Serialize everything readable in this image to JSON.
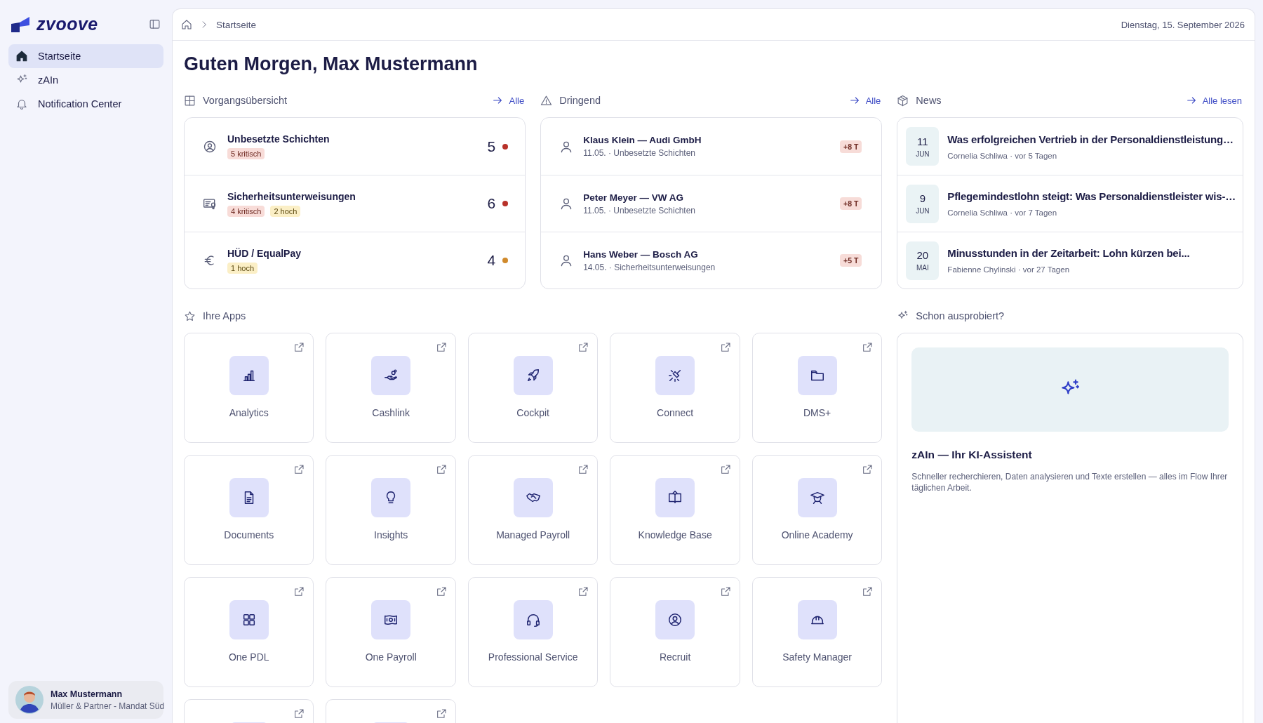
{
  "sidebar": {
    "brand": "zvoove",
    "items": [
      {
        "label": "Startseite",
        "selected": true
      },
      {
        "label": "zAIn",
        "selected": false
      },
      {
        "label": "Notification Center",
        "selected": false
      }
    ],
    "user": {
      "name": "Max Mustermann",
      "org": "Müller & Partner - Mandat Süd"
    }
  },
  "topbar": {
    "breadcrumb": [
      "Startseite"
    ],
    "date": "Dienstag, 15. September 2026"
  },
  "greeting": "Guten Morgen, Max Mustermann",
  "overview": {
    "title": "Vorgangsübersicht",
    "link": "Alle",
    "items": [
      {
        "title": "Unbesetzte Schichten",
        "badges": [
          {
            "text": "5 kritisch",
            "kind": "critical"
          }
        ],
        "count": "5",
        "color": "#b8322a"
      },
      {
        "title": "Sicherheitsunterweisungen",
        "badges": [
          {
            "text": "4 kritisch",
            "kind": "critical"
          },
          {
            "text": "2 hoch",
            "kind": "high"
          }
        ],
        "count": "6",
        "color": "#b8322a"
      },
      {
        "title": "HÜD / EqualPay",
        "badges": [
          {
            "text": "1 hoch",
            "kind": "high"
          }
        ],
        "count": "4",
        "color": "#d08a2c"
      }
    ]
  },
  "urgent": {
    "title": "Dringend",
    "link": "Alle",
    "items": [
      {
        "title": "Klaus Klein — Audi GmbH",
        "subtitle": "11.05. · Unbesetzte Schichten",
        "badge": "+8 T"
      },
      {
        "title": "Peter Meyer — VW AG",
        "subtitle": "11.05. · Unbesetzte Schichten",
        "badge": "+8 T"
      },
      {
        "title": "Hans Weber — Bosch AG",
        "subtitle": "14.05. · Sicherheitsunterweisungen",
        "badge": "+5 T"
      }
    ]
  },
  "news": {
    "title": "News",
    "link": "Alle lesen",
    "items": [
      {
        "day": "11",
        "month": "JUN",
        "title": "Was erfolgreichen Vertrieb in der Personaldienstleistung…",
        "meta": "Cornelia Schliwa · vor 5 Tagen"
      },
      {
        "day": "9",
        "month": "JUN",
        "title": "Pflegemindestlohn steigt: Was Personaldienstleister wis-…",
        "meta": "Cornelia Schliwa · vor 7 Tagen"
      },
      {
        "day": "20",
        "month": "MAI",
        "title": "Minusstunden in der Zeitarbeit: Lohn kürzen bei...",
        "meta": "Fabienne Chylinski · vor 27 Tagen"
      }
    ]
  },
  "apps": {
    "title": "Ihre Apps",
    "items": [
      {
        "kind": "app",
        "name": "Analytics"
      },
      {
        "kind": "app",
        "name": "Cashlink"
      },
      {
        "kind": "app",
        "name": "Cockpit"
      },
      {
        "kind": "app",
        "name": "Connect"
      },
      {
        "kind": "app",
        "name": "DMS+"
      },
      {
        "kind": "app",
        "name": "Documents"
      },
      {
        "kind": "app",
        "name": "Insights"
      },
      {
        "kind": "app",
        "name": "Managed Payroll"
      },
      {
        "kind": "app",
        "name": "Knowledge Base"
      },
      {
        "kind": "app",
        "name": "Online Academy"
      },
      {
        "kind": "app",
        "name": "One PDL"
      },
      {
        "kind": "app",
        "name": "One Payroll"
      },
      {
        "kind": "app",
        "name": "Professional Service"
      },
      {
        "kind": "app",
        "name": "Recruit"
      },
      {
        "kind": "app",
        "name": "Safety Manager"
      },
      {
        "kind": "app"
      },
      {
        "kind": "app"
      }
    ]
  },
  "promo": {
    "title": "Schon ausprobiert?",
    "heading": "zAIn — Ihr KI-Assistent",
    "text": "Schneller recherchieren, Daten analysieren und Texte erstellen — alles im Flow Ihrer täglichen Arbeit."
  }
}
